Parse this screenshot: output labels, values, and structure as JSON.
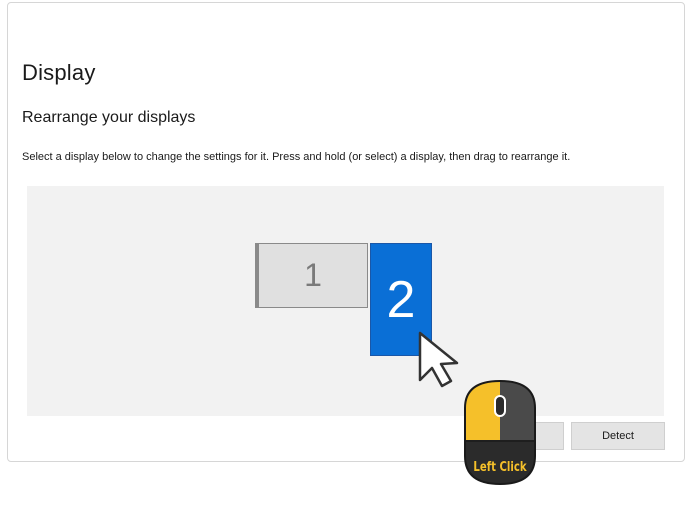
{
  "page": {
    "title": "Display",
    "section_title": "Rearrange your displays",
    "instructions": "Select a display below to change the settings for it. Press and hold (or select) a display, then drag to rearrange it."
  },
  "displays": [
    {
      "label": "1",
      "selected": false
    },
    {
      "label": "2",
      "selected": true
    }
  ],
  "buttons": {
    "identify_label": "",
    "detect_label": "Detect"
  },
  "overlay": {
    "mouse_hint": "Left Click",
    "mouse_icon": "mouse-left-click-icon",
    "cursor_icon": "arrow-cursor-icon"
  },
  "colors": {
    "selected_display": "#0a6fd6",
    "unselected_display": "#e0e0e0",
    "mouse_hint_highlight": "#f5c02a"
  }
}
